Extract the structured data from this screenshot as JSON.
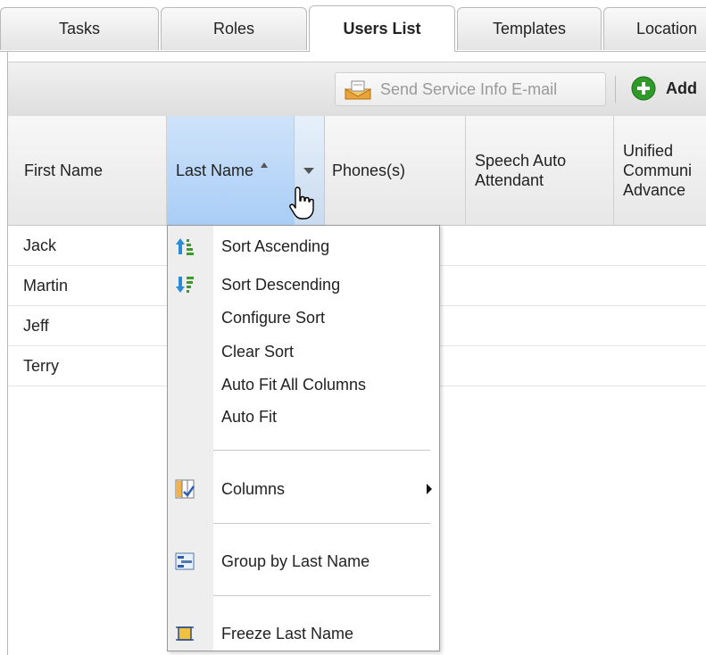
{
  "tabs": [
    "Tasks",
    "Roles",
    "Users List",
    "Templates",
    "Location"
  ],
  "toolbar": {
    "send_label": "Send Service Info E-mail",
    "add_label": "Add"
  },
  "columns": [
    "First Name",
    "Last Name",
    "Phones(s)",
    "Speech Auto Attendant",
    "Unified Communi Advance"
  ],
  "rows": [
    "Jack",
    "Martin",
    "Jeff",
    "Terry"
  ],
  "menu": {
    "sort_asc": "Sort Ascending",
    "sort_desc": "Sort Descending",
    "configure_sort": "Configure Sort",
    "clear_sort": "Clear Sort",
    "auto_fit_all": "Auto Fit All Columns",
    "auto_fit": "Auto Fit",
    "columns": "Columns",
    "group_by": "Group by Last Name",
    "freeze": "Freeze Last Name"
  },
  "colors": {
    "sorted_header": "#a9cdf6",
    "add_icon": "#2f9a2a"
  }
}
